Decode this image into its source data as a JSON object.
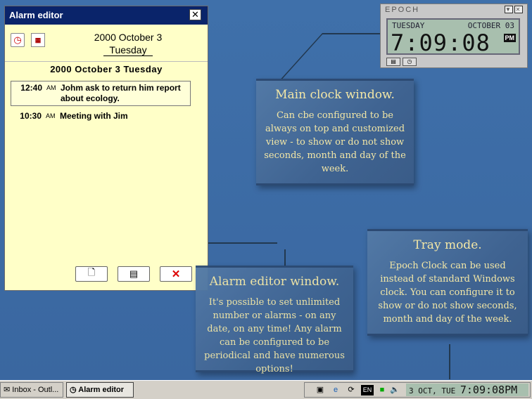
{
  "alarm_editor": {
    "title": "Alarm editor",
    "header_date": "2000 October 3",
    "header_day": "Tuesday",
    "day_heading": "2000  October  3  Tuesday",
    "alarms": [
      {
        "time": "12:40",
        "ampm": "AM",
        "text": "Johm ask to return him report about ecology."
      },
      {
        "time": "10:30",
        "ampm": "AM",
        "text": "Meeting with Jim"
      }
    ]
  },
  "epoch": {
    "title": "EPOCH",
    "day": "TUESDAY",
    "date": "OCTOBER 03",
    "time": "7:09:08",
    "ampm": "PM"
  },
  "callouts": {
    "main_clock": {
      "title": "Main clock window.",
      "body": "Can cbe configured to be always on top and customized view - to show or do not show seconds, month and day of the week."
    },
    "alarm_editor": {
      "title": "Alarm editor window.",
      "body": "It's possible to set unlimited number or alarms - on any date, on any time! Any alarm can be configured to be periodical and have numerous options!"
    },
    "tray": {
      "title": "Tray mode.",
      "body": "Epoch Clock can be used instead of standard Windows clock. You can configure it to show or do not show seconds, month and day of the week."
    }
  },
  "taskbar": {
    "tasks": [
      "Inbox - Outl...",
      "Alarm editor"
    ],
    "lang": "EN",
    "tray_clock": {
      "date": "3 OCT, TUE",
      "time": "7:09:08PM"
    }
  }
}
